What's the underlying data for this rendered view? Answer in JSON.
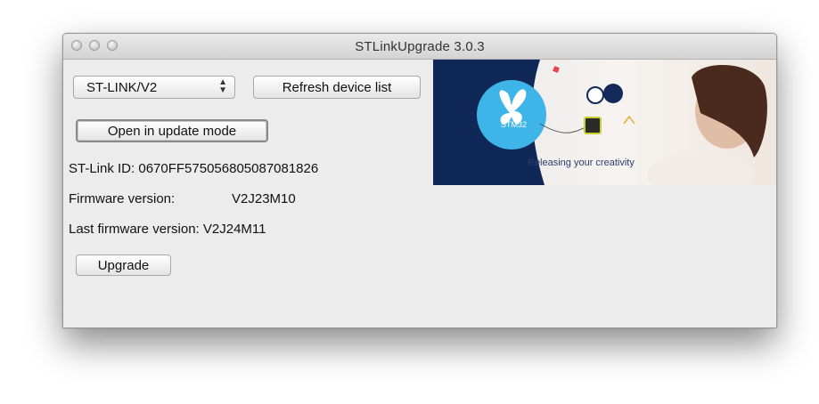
{
  "window": {
    "title": "STLinkUpgrade 3.0.3"
  },
  "device_select": {
    "value": "ST-LINK/V2"
  },
  "buttons": {
    "refresh": "Refresh device list",
    "update_mode": "Open in update mode",
    "upgrade": "Upgrade"
  },
  "info": {
    "stlink_id": "ST-Link ID: 0670FF575056805087081826",
    "firmware_label": "Firmware version:",
    "firmware_value": "V2J23M10",
    "last_firmware": "Last firmware version: V2J24M11"
  },
  "banner": {
    "logo_text": "STM32",
    "tagline": "Releasing your creativity"
  },
  "colors": {
    "navy": "#0f2857",
    "stm_blue": "#3fb4e8"
  }
}
